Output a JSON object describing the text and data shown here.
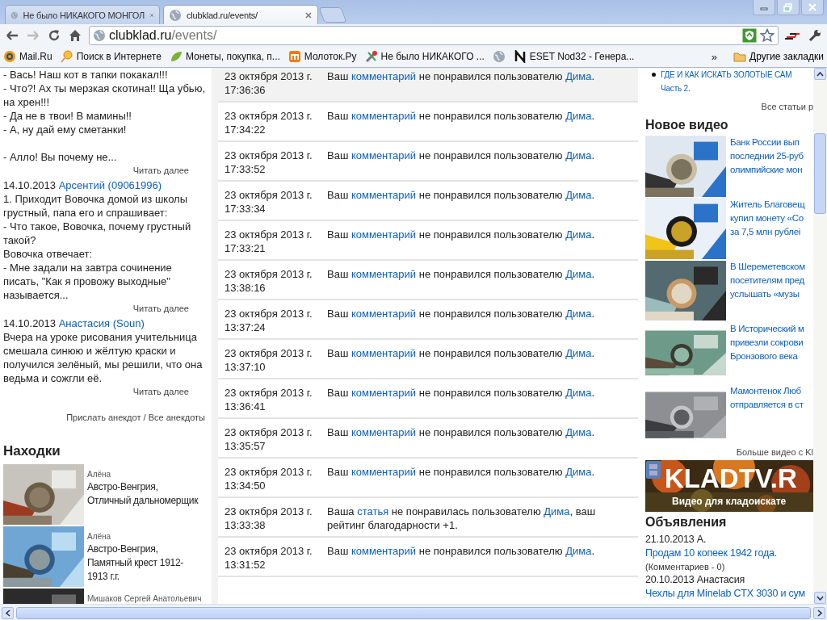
{
  "tabs": [
    {
      "title": "Не было НИКАКОГО МОНГОЛ",
      "selected": false
    },
    {
      "title": "clubklad.ru/events/",
      "selected": true
    }
  ],
  "address": {
    "host": "clubklad.ru",
    "path": "/events/"
  },
  "bookmarks": [
    {
      "kind": "link",
      "label": "Mail.Ru"
    },
    {
      "kind": "link",
      "label": "Поиск в Интернете"
    },
    {
      "kind": "link",
      "label": "Монеты, покупка, п..."
    },
    {
      "kind": "link",
      "label": "Молоток.Ру"
    },
    {
      "kind": "link",
      "label": "Не было НИКАКОГО ..."
    },
    {
      "kind": "icon"
    },
    {
      "kind": "link",
      "label": "ESET Nod32 - Генера..."
    }
  ],
  "bookmarks_more": "»",
  "other_bookmarks": "Другие закладки",
  "anecdotes": [
    {
      "paragraphs": [
        [
          "- Вась! Наш кот в тапки покакал!!!",
          "- Что?! Ах ты мерзкая скотина!! Ща убью,",
          "на хрен!!!",
          "- Да не в твои! В мамины!!",
          "- А, ну дай ему сметанки!"
        ],
        [
          "- Алло! Вы почему не..."
        ]
      ],
      "more": "Читать далее"
    },
    {
      "date": "14.10.2013",
      "author": "Арсентий (09061996)",
      "paragraphs": [
        [
          "1. Приходит Вовочка домой из школы",
          "грустный, папа его и спрашивает:",
          "- Что такое, Вовочка, почему грустный",
          "такой?",
          "Вовочка отвечает:",
          "- Мне задали на завтра сочинение",
          "писать, \"Как я провожу выходные\"",
          "называется..."
        ]
      ],
      "more": "Читать далее"
    },
    {
      "date": "14.10.2013",
      "author": "Анастасия (Soun)",
      "paragraphs": [
        [
          "Вчера на уроке рисования учительница",
          "смешала синюю и жёлтую краски и",
          "получился зелёный, мы решили, что она",
          "ведьма и сожгли её."
        ]
      ],
      "more": "Читать далее"
    }
  ],
  "anecdote_links": {
    "send": "Прислать анекдот",
    "separator": " / ",
    "all": "Все анекдоты"
  },
  "finds": {
    "heading": "Находки",
    "items": [
      {
        "author": "Алёна",
        "title": [
          "Австро-Венгрия,",
          "Отличный дальномерщик"
        ]
      },
      {
        "author": "Алёна",
        "title": [
          "Австро-Венгрия,",
          "Памятный крест 1912-",
          "1913 г.г."
        ]
      },
      {
        "author": "Мишаков Сергей Анатольевич"
      }
    ]
  },
  "events": [
    {
      "date": "23 октября 2013 г.",
      "time": "17:36:36",
      "before": "Ваш",
      "link": "комментарий",
      "middle": "не понравился пользователю",
      "user": "Дима",
      "after": ".",
      "highlighted": true
    },
    {
      "date": "23 октября 2013 г.",
      "time": "17:34:22",
      "before": "Ваш",
      "link": "комментарий",
      "middle": "не понравился пользователю",
      "user": "Дима",
      "after": ".",
      "highlighted": false
    },
    {
      "date": "23 октября 2013 г.",
      "time": "17:33:52",
      "before": "Ваш",
      "link": "комментарий",
      "middle": "не понравился пользователю",
      "user": "Дима",
      "after": ".",
      "highlighted": false
    },
    {
      "date": "23 октября 2013 г.",
      "time": "17:33:34",
      "before": "Ваш",
      "link": "комментарий",
      "middle": "не понравился пользователю",
      "user": "Дима",
      "after": ".",
      "highlighted": false
    },
    {
      "date": "23 октября 2013 г.",
      "time": "17:33:21",
      "before": "Ваш",
      "link": "комментарий",
      "middle": "не понравился пользователю",
      "user": "Дима",
      "after": ".",
      "highlighted": false
    },
    {
      "date": "23 октября 2013 г.",
      "time": "13:38:16",
      "before": "Ваш",
      "link": "комментарий",
      "middle": "не понравился пользователю",
      "user": "Дима",
      "after": ".",
      "highlighted": false
    },
    {
      "date": "23 октября 2013 г.",
      "time": "13:37:24",
      "before": "Ваш",
      "link": "комментарий",
      "middle": "не понравился пользователю",
      "user": "Дима",
      "after": ".",
      "highlighted": false
    },
    {
      "date": "23 октября 2013 г.",
      "time": "13:37:10",
      "before": "Ваш",
      "link": "комментарий",
      "middle": "не понравился пользователю",
      "user": "Дима",
      "after": ".",
      "highlighted": false
    },
    {
      "date": "23 октября 2013 г.",
      "time": "13:36:41",
      "before": "Ваш",
      "link": "комментарий",
      "middle": "не понравился пользователю",
      "user": "Дима",
      "after": ".",
      "highlighted": false
    },
    {
      "date": "23 октября 2013 г.",
      "time": "13:35:57",
      "before": "Ваш",
      "link": "комментарий",
      "middle": "не понравился пользователю",
      "user": "Дима",
      "after": ".",
      "highlighted": false
    },
    {
      "date": "23 октября 2013 г.",
      "time": "13:34:50",
      "before": "Ваш",
      "link": "комментарий",
      "middle": "не понравился пользователю",
      "user": "Дима",
      "after": ".",
      "highlighted": false
    },
    {
      "date": "23 октября 2013 г.",
      "time": "13:33:38",
      "before": "Ваша",
      "link": "статья",
      "middle": "не понравилась пользователю",
      "user": "Дима",
      "after": ", ваш рейтинг благодарности +1.",
      "highlighted": false
    },
    {
      "date": "23 октября 2013 г.",
      "time": "13:31:52",
      "before": "Ваш",
      "link": "комментарий",
      "middle": "не понравился пользователю",
      "user": "Дима",
      "after": ".",
      "highlighted": false
    }
  ],
  "articles": {
    "items": [
      [
        "ГДЕ И КАК ИСКАТЬ ЗОЛОТЫЕ САМ",
        "Часть 2."
      ]
    ],
    "all": "Все статьи р"
  },
  "videos": {
    "heading": "Новое видео",
    "items": [
      [
        "Банк России вып",
        "последнии 25-руб",
        "олимпийские мон"
      ],
      [
        "Житель Благовещ",
        "купил монету «Со",
        "за 7,5 млн рублеі"
      ],
      [
        "В Шереметевском",
        "посетителям пред",
        "услышать «музы"
      ],
      [
        "В Исторический м",
        "привезли сокрови",
        "Бронзового века"
      ],
      [
        "Мамонтенок Люб",
        "отправляется в ст"
      ]
    ],
    "more": "Больше видео с Kl"
  },
  "banner": {
    "title": "KLADTV.R",
    "subtitle": "Видео для кладоискате"
  },
  "ads": {
    "heading": "Объявления",
    "items": [
      {
        "date": "21.10.2013",
        "author": "А.",
        "title": "Продам 10 копеек 1942 года.",
        "comments": "(Комментариев - 0)"
      },
      {
        "date": "20.10.2013",
        "author": "Анастасия",
        "title": "Чехлы для Minelab CTX 3030 и сум"
      }
    ]
  }
}
